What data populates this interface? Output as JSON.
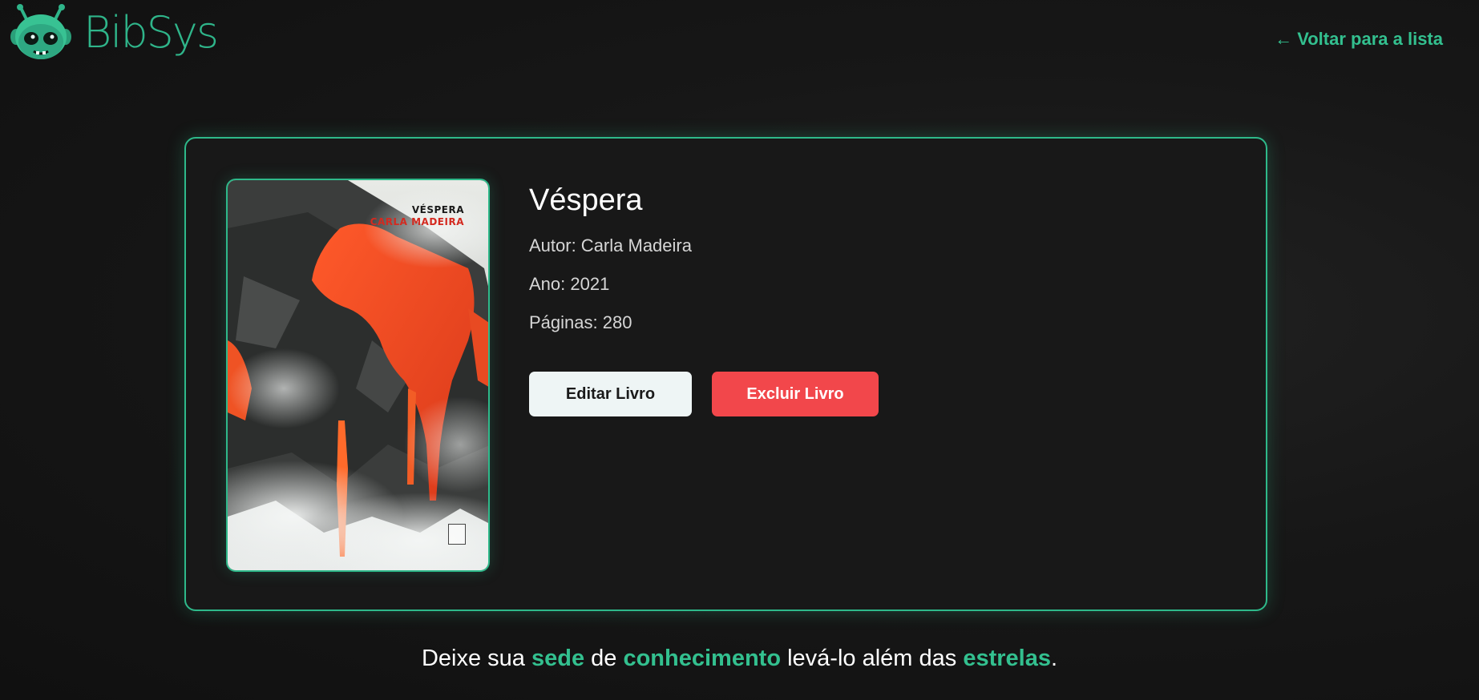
{
  "header": {
    "logo_text": "BibSys",
    "back_link": "← Voltar para a lista"
  },
  "book": {
    "cover_title": "VÉSPERA",
    "cover_author": "CARLA MADEIRA",
    "title": "Véspera",
    "author_line": "Autor: Carla Madeira",
    "year_line": "Ano: 2021",
    "pages_line": "Páginas: 280"
  },
  "actions": {
    "edit_label": "Editar Livro",
    "delete_label": "Excluir Livro"
  },
  "tagline": {
    "w1": "Deixe sua ",
    "h1": "sede",
    "w2": " de ",
    "h2": "conhecimento",
    "w3": " levá-lo além das ",
    "h3": "estrelas",
    "w4": "."
  },
  "colors": {
    "accent": "#2fb58a",
    "delete": "#f2474b",
    "edit": "#eef5f5",
    "background": "#161616"
  },
  "icons": {
    "logo": "alien-mascot-icon",
    "cover_publisher": "publisher-logo-icon"
  }
}
